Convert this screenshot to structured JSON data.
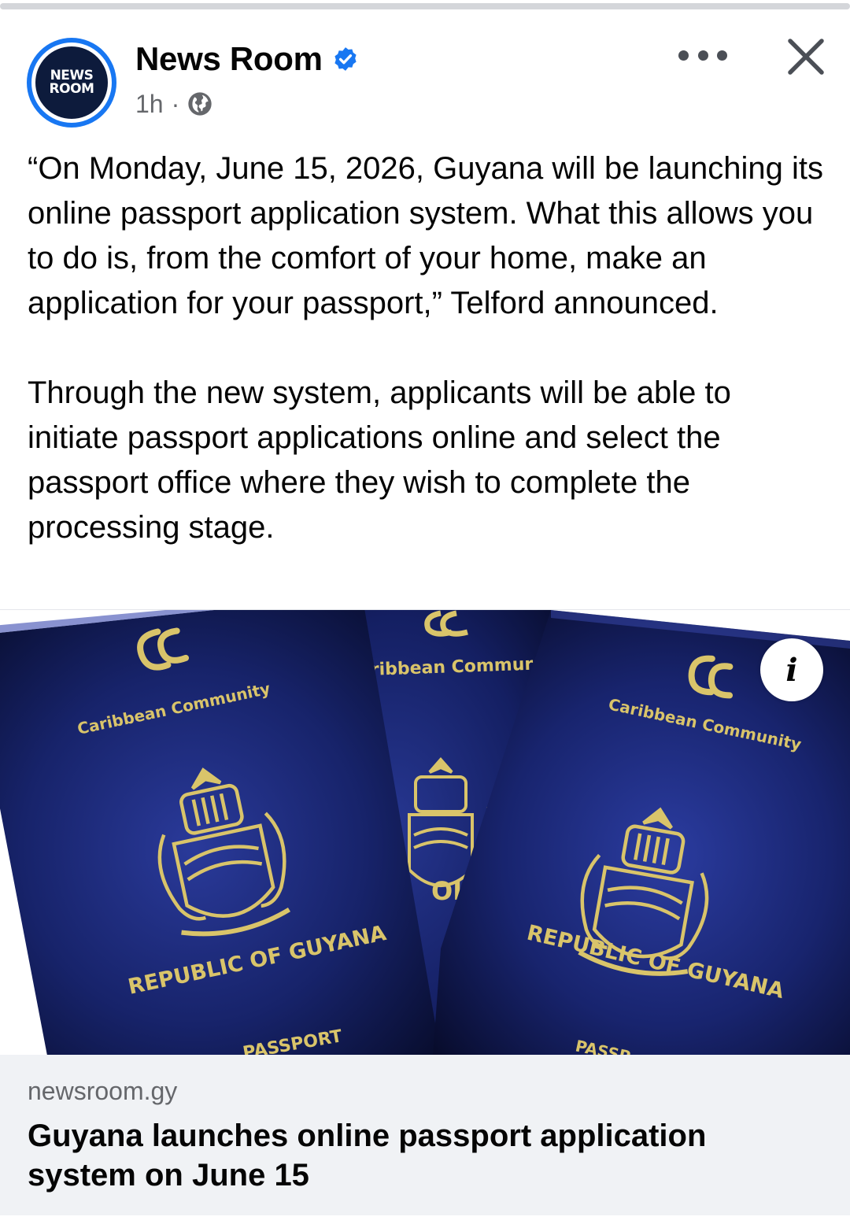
{
  "page": {
    "name": "News Room",
    "avatar_text_line1": "NEWS",
    "avatar_text_line2": "ROOM",
    "time": "1h",
    "separator": "·"
  },
  "icons": {
    "verified": "verified-badge-icon",
    "globe": "globe-icon",
    "more": "more-options-icon",
    "close": "close-icon",
    "info": "info-icon"
  },
  "post": {
    "paragraph1": "“On Monday, June 15, 2026, Guyana will be launching its online passport application system. What this allows you to do is, from the comfort of your home, make an application for your passport,” Telford announced.",
    "paragraph2": "Through the new system, applicants will be able to initiate passport applications online and select the passport office where they wish to complete the processing stage."
  },
  "image": {
    "left_cover": {
      "community": "Caribbean Community",
      "country": "REPUBLIC OF GUYANA",
      "doc": "PASSPORT"
    },
    "middle_cover": {
      "community": "Caribbean Commur",
      "country": "OI"
    },
    "right_cover": {
      "community": "Caribbean Community",
      "country": "REPUBLIC OF GUYANA",
      "doc": "PASSP"
    },
    "info_label": "i"
  },
  "link": {
    "domain": "newsroom.gy",
    "title": "Guyana launches online passport application system on June 15"
  },
  "colors": {
    "accent_blue": "#1877f2",
    "passport_blue": "#15205e",
    "gold": "#d9c46a",
    "link_bg": "#f0f2f5"
  }
}
